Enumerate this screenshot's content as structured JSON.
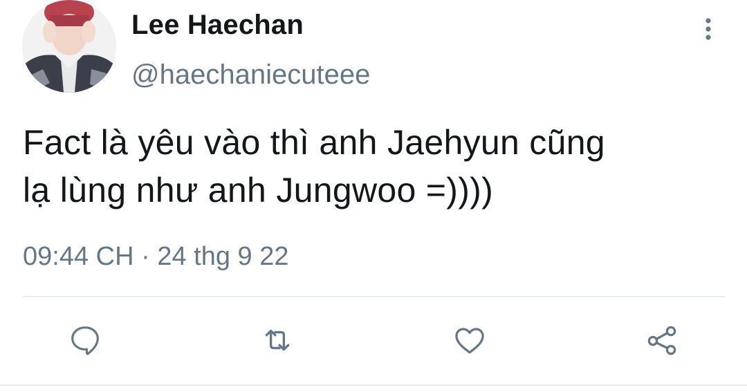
{
  "tweet": {
    "author": {
      "display_name": "Lee Haechan",
      "handle": "@haechaniecuteee"
    },
    "text_line_1": "Fact là yêu vào thì anh Jaehyun cũng",
    "text_line_2": "lạ lùng như anh Jungwoo =))))",
    "timestamp": "09:44 CH · 24 thg 9 22"
  },
  "actions": {
    "reply_icon": "reply-icon",
    "retweet_icon": "retweet-icon",
    "like_icon": "heart-icon",
    "share_icon": "share-icon"
  },
  "colors": {
    "text_primary": "#14171a",
    "text_secondary": "#657786",
    "divider": "#e6ecf0",
    "icon": "#657786"
  }
}
